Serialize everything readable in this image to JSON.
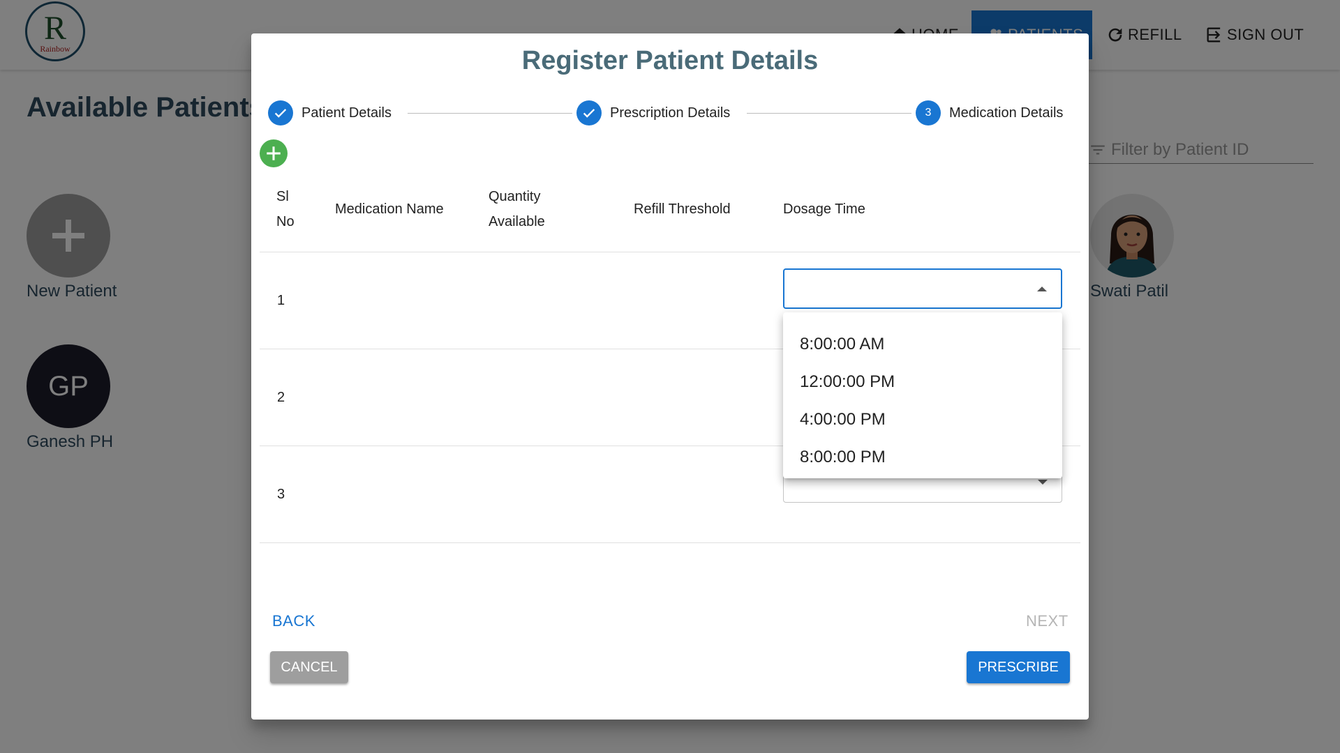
{
  "app": {
    "logo_text": "Rainbow",
    "nav": {
      "home": "HOME",
      "patients": "PATIENTS",
      "refill": "REFILL",
      "sign_out": "SIGN OUT"
    },
    "page_title": "Available Patients",
    "filter_placeholder": "Filter by Patient ID",
    "patients": [
      {
        "name": "New Patient"
      },
      {
        "name": "Ganesh PH",
        "initials": "GP"
      },
      {
        "name": "Swati Patil"
      }
    ]
  },
  "dialog": {
    "title": "Register Patient Details",
    "steps": [
      {
        "label": "Patient Details",
        "state": "completed"
      },
      {
        "label": "Prescription Details",
        "state": "completed"
      },
      {
        "label": "Medication Details",
        "number": "3",
        "state": "active"
      }
    ],
    "table": {
      "headers": {
        "sl_no_line1": "Sl",
        "sl_no_line2": "No",
        "medication_name": "Medication Name",
        "quantity_line1": "Quantity",
        "quantity_line2": "Available",
        "refill_threshold": "Refill Threshold",
        "dosage_time": "Dosage Time"
      },
      "rows": [
        {
          "sl_no": "1",
          "dosage_time": ""
        },
        {
          "sl_no": "2",
          "dosage_time": ""
        },
        {
          "sl_no": "3",
          "dosage_time": ""
        }
      ]
    },
    "dosage_menu": {
      "options": [
        "8:00:00 AM",
        "12:00:00 PM",
        "4:00:00 PM",
        "8:00:00 PM"
      ]
    },
    "buttons": {
      "back": "BACK",
      "next": "NEXT",
      "cancel": "CANCEL",
      "prescribe": "PRESCRIBE"
    }
  },
  "colors": {
    "primary": "#1976d2",
    "success": "#4caf50",
    "title": "#4a6b78",
    "disabled": "#9e9e9e"
  }
}
